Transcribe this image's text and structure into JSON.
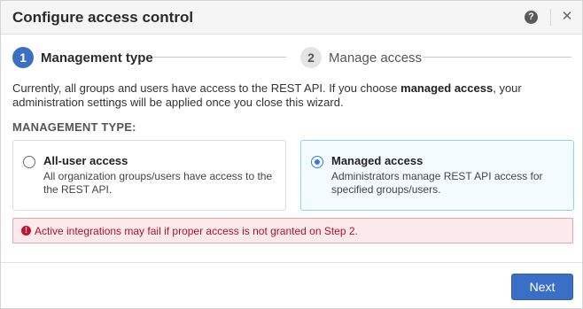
{
  "dialog": {
    "title": "Configure access control",
    "help_icon_glyph": "?",
    "close_icon_glyph": "✕"
  },
  "steps": [
    {
      "number": "1",
      "label": "Management type",
      "active": true
    },
    {
      "number": "2",
      "label": "Manage access",
      "active": false
    }
  ],
  "description": {
    "part1": "Currently, all groups and users have access to the REST API. If you choose ",
    "bold": "managed access",
    "part2": ", your administration settings will be applied once you close this wizard."
  },
  "management_type": {
    "section_label": "MANAGEMENT TYPE:",
    "options": [
      {
        "title": "All-user access",
        "description": "All organization groups/users have access to the the REST API.",
        "selected": false
      },
      {
        "title": "Managed access",
        "description": "Administrators manage REST API access for specified groups/users.",
        "selected": true
      }
    ]
  },
  "alert": {
    "icon_glyph": "!",
    "text": "Active integrations may fail if proper access is not granted on Step 2."
  },
  "footer": {
    "next_label": "Next"
  },
  "colors": {
    "accent": "#3a6fc7",
    "selected_border": "#8fd3f0",
    "alert_text": "#b01128",
    "alert_bg": "#fbe9ec"
  }
}
